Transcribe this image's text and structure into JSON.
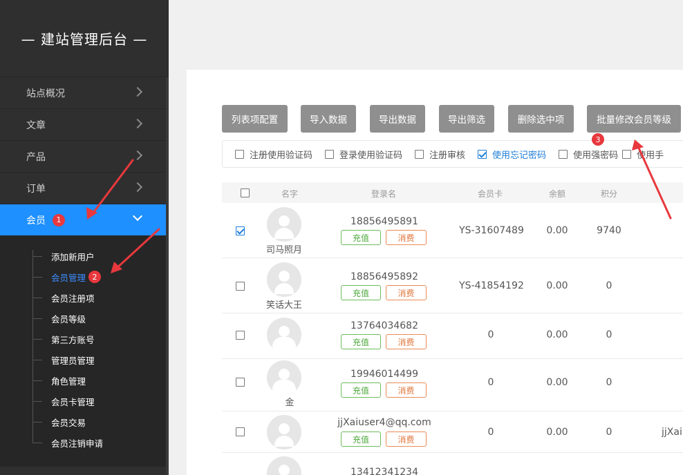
{
  "app": {
    "title": "— 建站管理后台 —"
  },
  "sidebar": {
    "items": [
      {
        "label": "站点概况"
      },
      {
        "label": "文章"
      },
      {
        "label": "产品"
      },
      {
        "label": "订单"
      },
      {
        "label": "会员",
        "badge": "1"
      }
    ],
    "submenu": [
      {
        "label": "添加新用户"
      },
      {
        "label": "会员管理",
        "badge": "2"
      },
      {
        "label": "会员注册项"
      },
      {
        "label": "会员等级"
      },
      {
        "label": "第三方账号"
      },
      {
        "label": "管理员管理"
      },
      {
        "label": "角色管理"
      },
      {
        "label": "会员卡管理"
      },
      {
        "label": "会员交易"
      },
      {
        "label": "会员注销申请"
      }
    ]
  },
  "toolbar": {
    "buttons": [
      "列表项配置",
      "导入数据",
      "导出数据",
      "导出筛选",
      "删除选中项",
      "批量修改会员等级"
    ],
    "badge": "3"
  },
  "options": [
    {
      "label": "注册使用验证码",
      "checked": false
    },
    {
      "label": "登录使用验证码",
      "checked": false
    },
    {
      "label": "注册审核",
      "checked": false
    },
    {
      "label": "使用忘记密码",
      "checked": true
    },
    {
      "label": "使用强密码",
      "checked": false
    },
    {
      "label": "使用手",
      "checked": false
    }
  ],
  "table": {
    "headers": [
      "名字",
      "登录名",
      "会员卡",
      "余额",
      "积分"
    ],
    "recharge_label": "充值",
    "consume_label": "消费",
    "rows": [
      {
        "checked": true,
        "nickname": "司马照月",
        "login": "18856495891",
        "card": "YS-31607489",
        "balance": "0.00",
        "points": "9740",
        "extra": ""
      },
      {
        "checked": false,
        "nickname": "笑话大王",
        "login": "18856495892",
        "card": "YS-41854192",
        "balance": "0.00",
        "points": "0",
        "extra": ""
      },
      {
        "checked": false,
        "nickname": "",
        "login": "13764034682",
        "card": "0",
        "balance": "0.00",
        "points": "0",
        "extra": ""
      },
      {
        "checked": false,
        "nickname": "金",
        "login": "19946014499",
        "card": "0",
        "balance": "0.00",
        "points": "0",
        "extra": ""
      },
      {
        "checked": false,
        "nickname": "",
        "login": "jjXaiuser4@qq.com",
        "card": "0",
        "balance": "0.00",
        "points": "0",
        "extra": "jjXai"
      },
      {
        "checked": false,
        "nickname": "",
        "login": "13412341234",
        "card": "",
        "balance": "",
        "points": "",
        "extra": ""
      }
    ]
  },
  "colors": {
    "sidebar_bg": "#2f2f2f",
    "active": "#1e90ff",
    "annotation": "#e8383d",
    "recharge": "#4ca93a",
    "consume": "#e0753b"
  }
}
